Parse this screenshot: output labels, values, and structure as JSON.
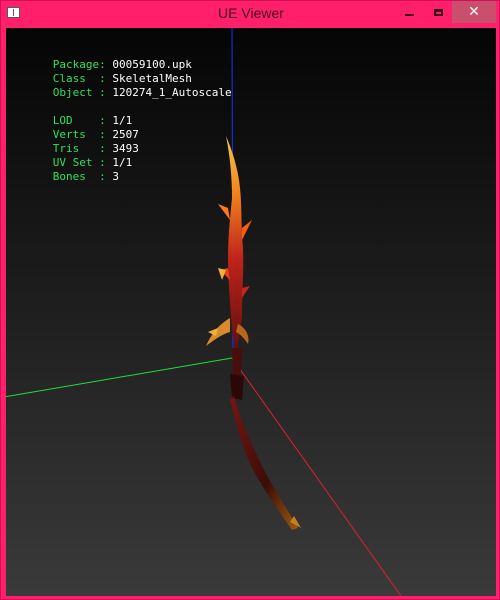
{
  "window": {
    "title": "UE Viewer",
    "buttons": {
      "minimize": "minimize",
      "maximize": "maximize",
      "close": "close"
    }
  },
  "info": {
    "package": {
      "label": "Package:",
      "value": "00059100.upk"
    },
    "class": {
      "label": "Class  :",
      "value": "SkeletalMesh"
    },
    "object": {
      "label": "Object :",
      "value": "120274_1_Autoscale"
    },
    "lod": {
      "label": "LOD    :",
      "value": "1/1"
    },
    "verts": {
      "label": "Verts  :",
      "value": "2507"
    },
    "tris": {
      "label": "Tris   :",
      "value": "3493"
    },
    "uvset": {
      "label": "UV Set :",
      "value": "1/1"
    },
    "bones": {
      "label": "Bones  :",
      "value": "3"
    }
  },
  "colors": {
    "titlebar": "#ff1f6b",
    "axis_x": "#e0202a",
    "axis_y": "#1fe03a",
    "axis_z": "#2430ff",
    "label": "#2fe05a",
    "value": "#ffffff"
  },
  "icons": [
    "app-icon",
    "minimize-icon",
    "maximize-icon",
    "close-icon"
  ]
}
